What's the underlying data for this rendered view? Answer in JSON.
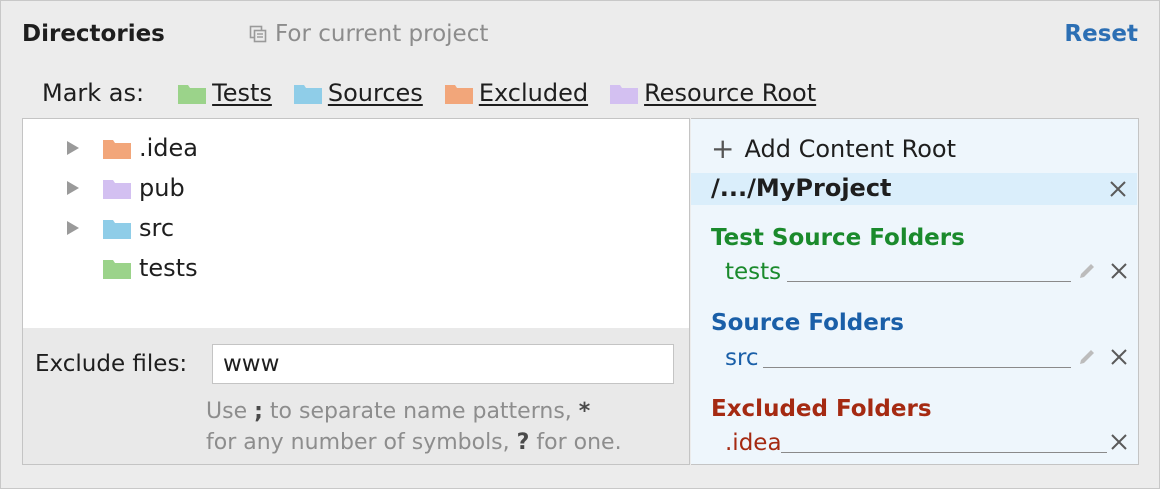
{
  "header": {
    "title": "Directories",
    "scope": "For current project",
    "reset_label": "Reset"
  },
  "mark_as": {
    "label": "Mark as:",
    "options": [
      {
        "label": "Tests",
        "color": "#9bd38a"
      },
      {
        "label": "Sources",
        "color": "#8fcde8"
      },
      {
        "label": "Excluded",
        "color": "#f2a67a"
      },
      {
        "label": "Resource Root",
        "color": "#d3c0f1"
      }
    ]
  },
  "tree": {
    "items": [
      {
        "label": ".idea",
        "color": "#f2a67a",
        "expandable": true
      },
      {
        "label": "pub",
        "color": "#d3c0f1",
        "expandable": true
      },
      {
        "label": "src",
        "color": "#8fcde8",
        "expandable": true
      },
      {
        "label": "tests",
        "color": "#9bd38a",
        "expandable": false
      }
    ]
  },
  "exclude": {
    "label": "Exclude files:",
    "value": "www",
    "hint_line1": [
      "Use ",
      ";",
      " to separate name patterns, ",
      "*"
    ],
    "hint_line2": [
      "for any number of symbols, ",
      "?",
      " for one."
    ]
  },
  "roots": {
    "add_label": "Add Content Root",
    "path": "/.../MyProject",
    "sections": [
      {
        "title": "Test Source Folders",
        "entry": "tests",
        "color": "#1a8a2c",
        "editable": true
      },
      {
        "title": "Source Folders",
        "entry": "src",
        "color": "#1a5fa8",
        "editable": true
      },
      {
        "title": "Excluded Folders",
        "entry": ".idea",
        "color": "#a52a12",
        "editable": false
      }
    ]
  }
}
